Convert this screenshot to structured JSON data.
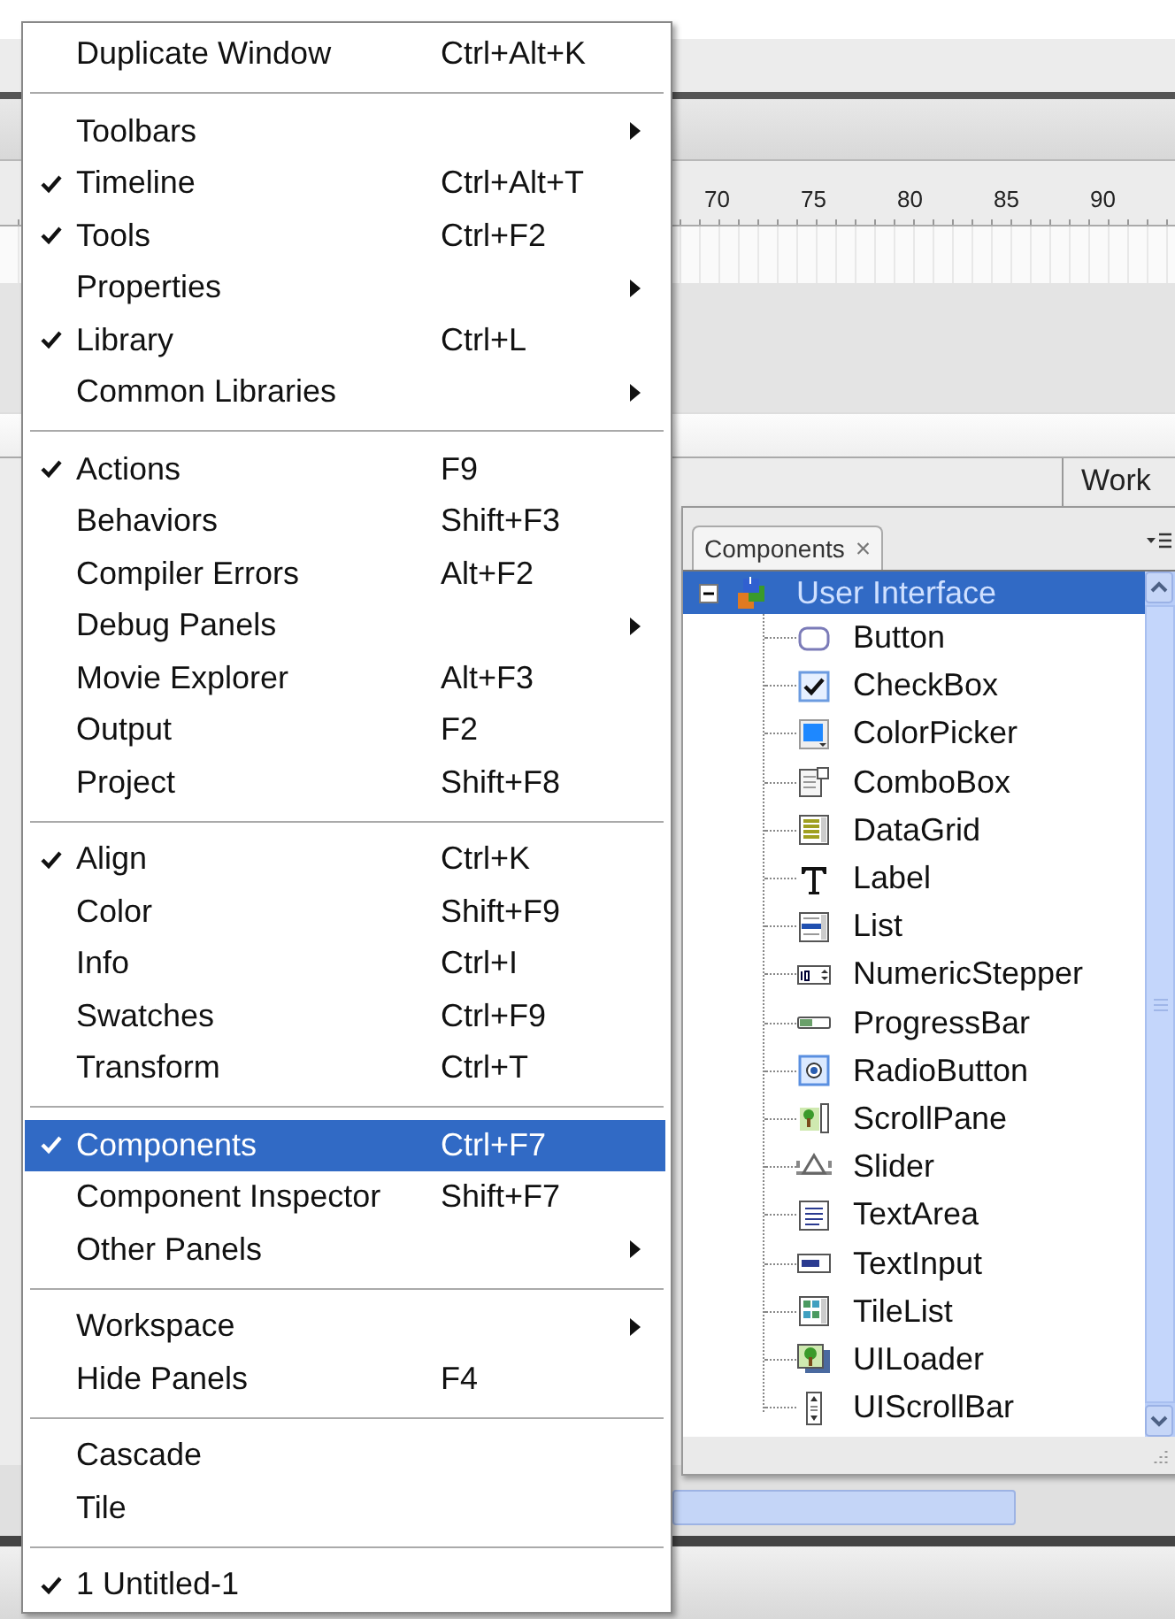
{
  "menu": {
    "items": [
      {
        "kind": "item",
        "label": "Duplicate Window",
        "shortcut": "Ctrl+Alt+K",
        "checked": false,
        "submenu": false,
        "selected": false
      },
      {
        "kind": "separator"
      },
      {
        "kind": "item",
        "label": "Toolbars",
        "checked": false,
        "submenu": true,
        "selected": false
      },
      {
        "kind": "item",
        "label": "Timeline",
        "shortcut": "Ctrl+Alt+T",
        "checked": true,
        "submenu": false,
        "selected": false
      },
      {
        "kind": "item",
        "label": "Tools",
        "shortcut": "Ctrl+F2",
        "checked": true,
        "submenu": false,
        "selected": false
      },
      {
        "kind": "item",
        "label": "Properties",
        "checked": false,
        "submenu": true,
        "selected": false
      },
      {
        "kind": "item",
        "label": "Library",
        "shortcut": "Ctrl+L",
        "checked": true,
        "submenu": false,
        "selected": false
      },
      {
        "kind": "item",
        "label": "Common Libraries",
        "checked": false,
        "submenu": true,
        "selected": false
      },
      {
        "kind": "separator"
      },
      {
        "kind": "item",
        "label": "Actions",
        "shortcut": "F9",
        "checked": true,
        "submenu": false,
        "selected": false
      },
      {
        "kind": "item",
        "label": "Behaviors",
        "shortcut": "Shift+F3",
        "checked": false,
        "submenu": false,
        "selected": false
      },
      {
        "kind": "item",
        "label": "Compiler Errors",
        "shortcut": "Alt+F2",
        "checked": false,
        "submenu": false,
        "selected": false
      },
      {
        "kind": "item",
        "label": "Debug Panels",
        "checked": false,
        "submenu": true,
        "selected": false
      },
      {
        "kind": "item",
        "label": "Movie Explorer",
        "shortcut": "Alt+F3",
        "checked": false,
        "submenu": false,
        "selected": false
      },
      {
        "kind": "item",
        "label": "Output",
        "shortcut": "F2",
        "checked": false,
        "submenu": false,
        "selected": false
      },
      {
        "kind": "item",
        "label": "Project",
        "shortcut": "Shift+F8",
        "checked": false,
        "submenu": false,
        "selected": false
      },
      {
        "kind": "separator"
      },
      {
        "kind": "item",
        "label": "Align",
        "shortcut": "Ctrl+K",
        "checked": true,
        "submenu": false,
        "selected": false
      },
      {
        "kind": "item",
        "label": "Color",
        "shortcut": "Shift+F9",
        "checked": false,
        "submenu": false,
        "selected": false
      },
      {
        "kind": "item",
        "label": "Info",
        "shortcut": "Ctrl+I",
        "checked": false,
        "submenu": false,
        "selected": false
      },
      {
        "kind": "item",
        "label": "Swatches",
        "shortcut": "Ctrl+F9",
        "checked": false,
        "submenu": false,
        "selected": false
      },
      {
        "kind": "item",
        "label": "Transform",
        "shortcut": "Ctrl+T",
        "checked": false,
        "submenu": false,
        "selected": false
      },
      {
        "kind": "separator"
      },
      {
        "kind": "item",
        "label": "Components",
        "shortcut": "Ctrl+F7",
        "checked": true,
        "submenu": false,
        "selected": true
      },
      {
        "kind": "item",
        "label": "Component Inspector",
        "shortcut": "Shift+F7",
        "checked": false,
        "submenu": false,
        "selected": false
      },
      {
        "kind": "item",
        "label": "Other Panels",
        "checked": false,
        "submenu": true,
        "selected": false
      },
      {
        "kind": "separator"
      },
      {
        "kind": "item",
        "label": "Workspace",
        "checked": false,
        "submenu": true,
        "selected": false
      },
      {
        "kind": "item",
        "label": "Hide Panels",
        "shortcut": "F4",
        "checked": false,
        "submenu": false,
        "selected": false
      },
      {
        "kind": "separator"
      },
      {
        "kind": "item",
        "label": "Cascade",
        "checked": false,
        "submenu": false,
        "selected": false
      },
      {
        "kind": "item",
        "label": "Tile",
        "checked": false,
        "submenu": false,
        "selected": false
      },
      {
        "kind": "separator"
      },
      {
        "kind": "item",
        "label": "1 Untitled-1",
        "checked": true,
        "submenu": false,
        "selected": false
      }
    ]
  },
  "timeline": {
    "ruler_labels": [
      "70",
      "75",
      "80",
      "85",
      "90"
    ]
  },
  "side_panel": {
    "label": "Work"
  },
  "components_panel": {
    "tab": {
      "label": "Components",
      "close": "×"
    },
    "tree": {
      "label": "User Interface",
      "expanded": true,
      "selected": true,
      "children": [
        {
          "label": "Button"
        },
        {
          "label": "CheckBox"
        },
        {
          "label": "ColorPicker"
        },
        {
          "label": "ComboBox"
        },
        {
          "label": "DataGrid"
        },
        {
          "label": "Label"
        },
        {
          "label": "List"
        },
        {
          "label": "NumericStepper"
        },
        {
          "label": "ProgressBar"
        },
        {
          "label": "RadioButton"
        },
        {
          "label": "ScrollPane"
        },
        {
          "label": "Slider"
        },
        {
          "label": "TextArea"
        },
        {
          "label": "TextInput"
        },
        {
          "label": "TileList"
        },
        {
          "label": "UILoader"
        },
        {
          "label": "UIScrollBar"
        }
      ]
    }
  }
}
